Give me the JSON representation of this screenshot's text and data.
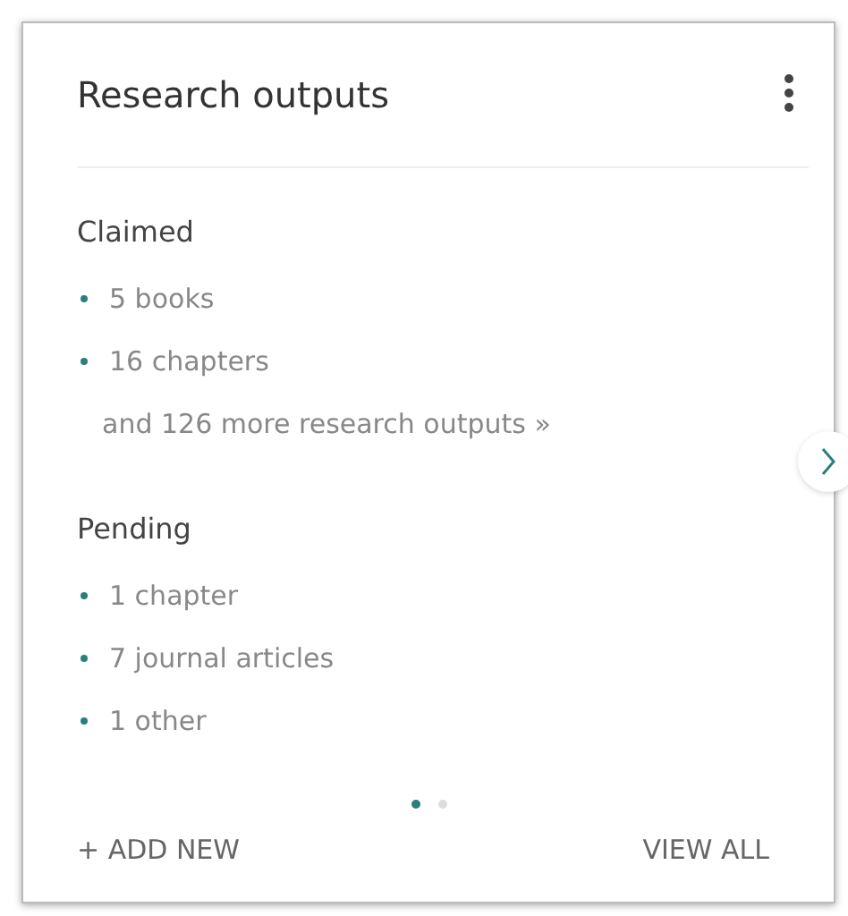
{
  "card": {
    "title": "Research outputs"
  },
  "sections": [
    {
      "heading": "Claimed",
      "items": [
        "5 books",
        "16 chapters"
      ],
      "more": "and 126 more research outputs »"
    },
    {
      "heading": "Pending",
      "items": [
        "1 chapter",
        "7 journal articles",
        "1 other"
      ]
    }
  ],
  "pages": [
    {
      "selected": true
    },
    {
      "selected": false
    }
  ],
  "footer": {
    "add": "+ ADD NEW",
    "view_all": "VIEW ALL"
  }
}
